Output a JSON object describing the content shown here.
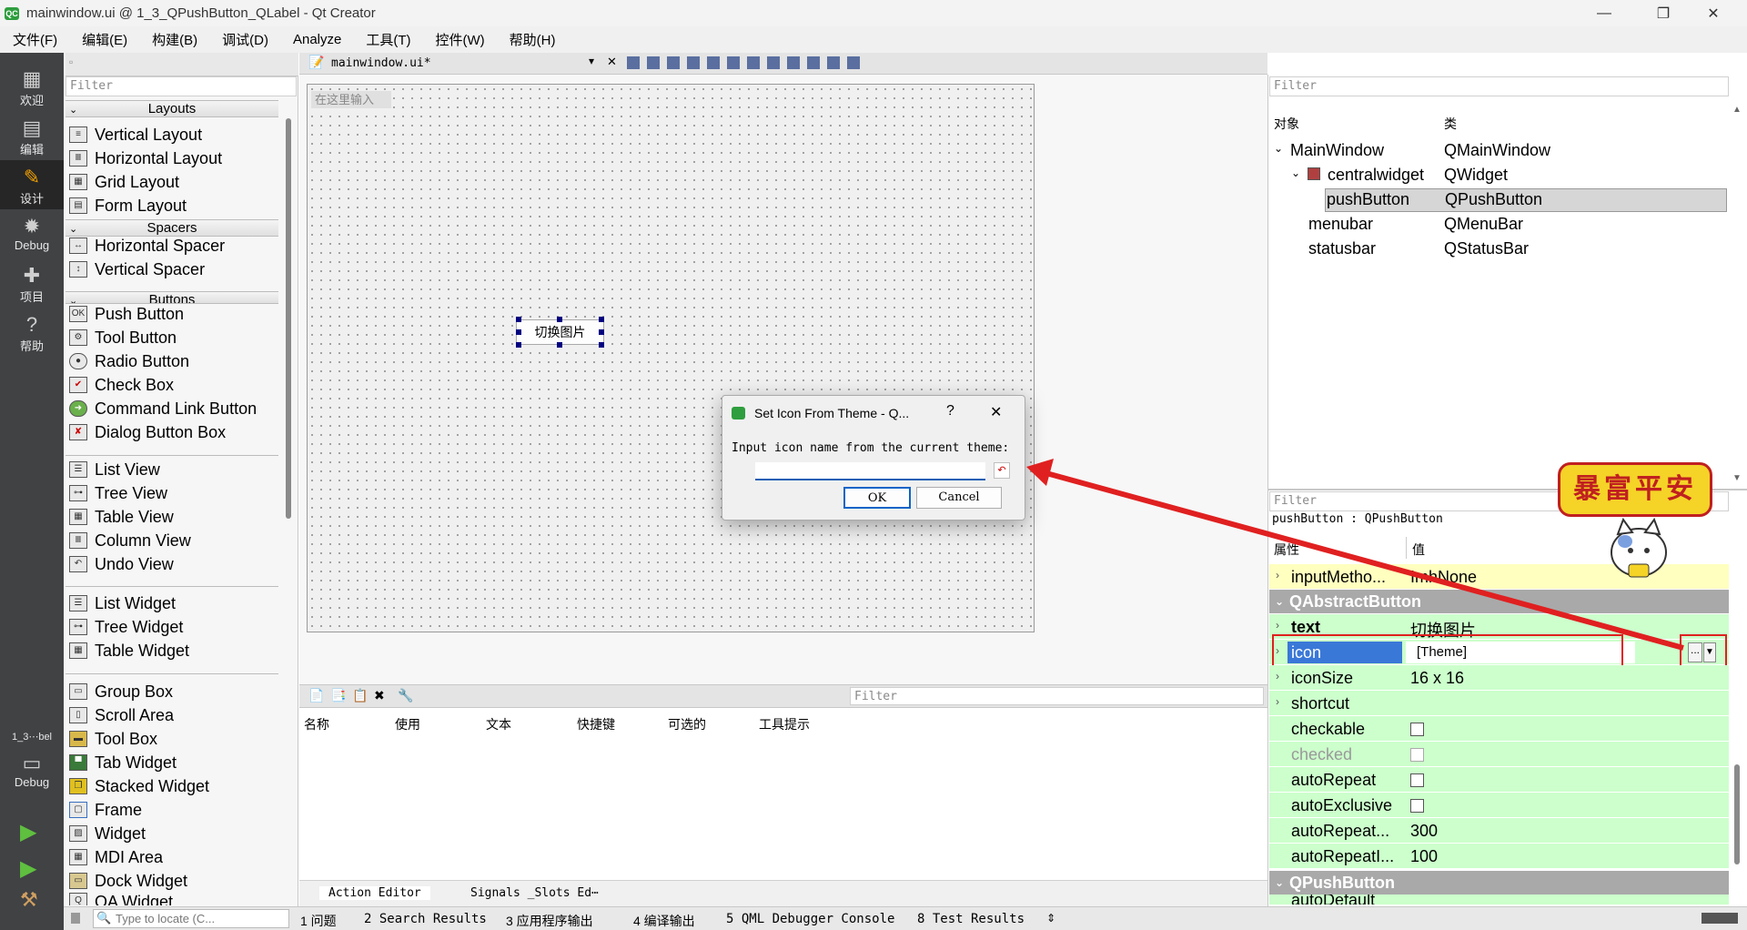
{
  "window": {
    "title": "mainwindow.ui @ 1_3_QPushButton_QLabel - Qt Creator",
    "logo": "QC",
    "min_glyph": "—",
    "max_glyph": "❐",
    "close_glyph": "✕"
  },
  "menu": [
    "文件(F)",
    "编辑(E)",
    "构建(B)",
    "调试(D)",
    "Analyze",
    "工具(T)",
    "控件(W)",
    "帮助(H)"
  ],
  "modes": [
    {
      "label": "欢迎",
      "icon": "grid-icon",
      "glyph": "▦"
    },
    {
      "label": "编辑",
      "icon": "document-icon",
      "glyph": "▤"
    },
    {
      "label": "设计",
      "icon": "pencil-icon",
      "glyph": "✎"
    },
    {
      "label": "Debug",
      "icon": "bug-icon",
      "glyph": "✹"
    },
    {
      "label": "项目",
      "icon": "wrench-icon",
      "glyph": "✚"
    },
    {
      "label": "帮助",
      "icon": "help-icon",
      "glyph": "?"
    }
  ],
  "kit": {
    "project": "1_3⋯bel",
    "label": "Debug",
    "glyph": "▭"
  },
  "run_glyphs": {
    "run": "▶",
    "debug_run": "▶",
    "build": "⚒"
  },
  "editor_tab": {
    "file": "mainwindow.ui*"
  },
  "widgetbox": {
    "filter_placeholder": "Filter",
    "categories": [
      {
        "name": "Layouts"
      },
      {
        "name": "Spacers"
      },
      {
        "name": "Buttons"
      }
    ],
    "items": [
      "Vertical Layout",
      "Horizontal Layout",
      "Grid Layout",
      "Form Layout",
      "Horizontal Spacer",
      "Vertical Spacer",
      "Push Button",
      "Tool Button",
      "Radio Button",
      "Check Box",
      "Command Link Button",
      "Dialog Button Box",
      "List View",
      "Tree View",
      "Table View",
      "Column View",
      "Undo View",
      "List Widget",
      "Tree Widget",
      "Table Widget",
      "Group Box",
      "Scroll Area",
      "Tool Box",
      "Tab Widget",
      "Stacked Widget",
      "Frame",
      "Widget",
      "MDI Area",
      "Dock Widget",
      "QA Widget"
    ],
    "push_button_icon": "OK"
  },
  "form": {
    "type_here": "在这里输入",
    "push_button_text": "切换图片"
  },
  "action_editor": {
    "filter_placeholder": "Filter",
    "columns": [
      "名称",
      "使用",
      "文本",
      "快捷键",
      "可选的",
      "工具提示"
    ],
    "tabs": [
      "Action Editor",
      "Signals _Slots Ed⋯"
    ]
  },
  "object_inspector": {
    "filter_placeholder": "Filter",
    "col_object": "对象",
    "col_class": "类",
    "rows": [
      {
        "name": "MainWindow",
        "cls": "QMainWindow"
      },
      {
        "name": "centralwidget",
        "cls": "QWidget"
      },
      {
        "name": "pushButton",
        "cls": "QPushButton"
      },
      {
        "name": "menubar",
        "cls": "QMenuBar"
      },
      {
        "name": "statusbar",
        "cls": "QStatusBar"
      }
    ]
  },
  "property_editor": {
    "filter_placeholder": "Filter",
    "object_label": "pushButton : QPushButton",
    "col_property": "属性",
    "col_value": "值",
    "input_method_name": "inputMetho...",
    "input_method_value": "ImhNone",
    "group_abstract": "QAbstractButton",
    "group_push": "QPushButton",
    "text_name": "text",
    "text_value": "切换图片",
    "icon_name": "icon",
    "icon_value": "[Theme]",
    "icon_more": "...",
    "iconsize_name": "iconSize",
    "iconsize_value": "16 x 16",
    "shortcut_name": "shortcut",
    "checkable_name": "checkable",
    "checked_name": "checked",
    "autorepeat_name": "autoRepeat",
    "autoexclusive_name": "autoExclusive",
    "autorepeat_delay_name": "autoRepeat...",
    "autorepeat_delay_value": "300",
    "autorepeat_interval_name": "autoRepeatI...",
    "autorepeat_interval_value": "100",
    "autodefault_name": "autoDefault",
    "group_color": "#a9a9a9",
    "row_green": "#ccffcc",
    "row_yellow": "#ffffbf"
  },
  "dialog": {
    "title": "Set Icon From Theme - Q...",
    "help": "?",
    "close": "✕",
    "label": "Input icon name from the current theme:",
    "input_value": "",
    "ok": "OK",
    "cancel": "Cancel"
  },
  "overlay": {
    "sticker_text": "暴富平安",
    "arrow_color": "#e02020"
  },
  "statusbar": {
    "locate_placeholder": "Type to locate (C...",
    "items": [
      "1 问题",
      "2 Search Results",
      "3 应用程序输出",
      "4 编译输出",
      "5 QML Debugger Console",
      "8 Test Results"
    ]
  }
}
